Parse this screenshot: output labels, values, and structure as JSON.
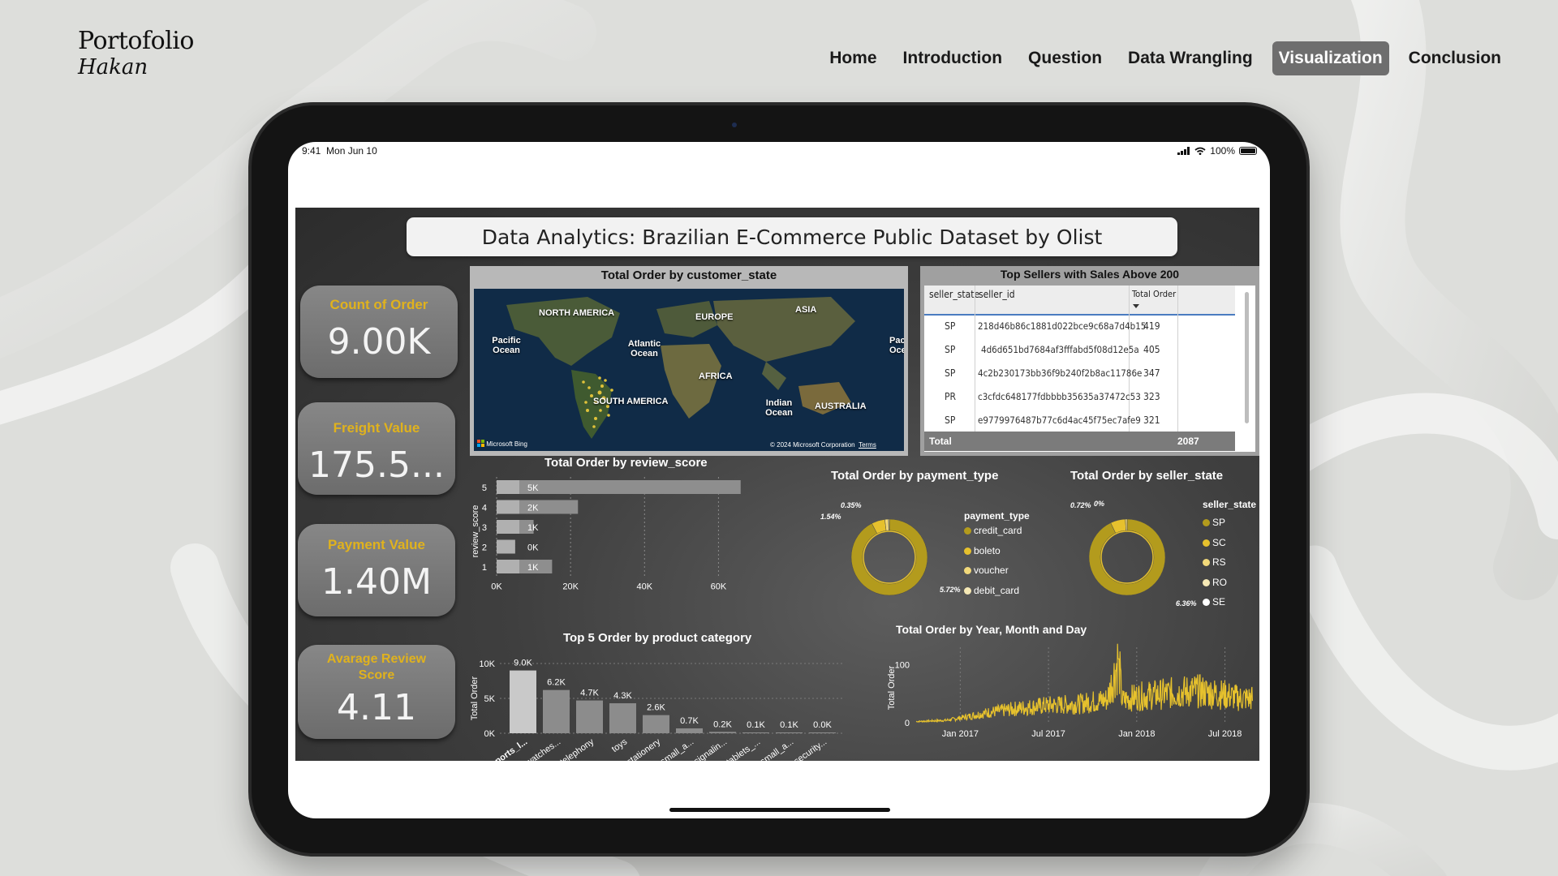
{
  "brand": {
    "name": "Portofolio",
    "sub": "Hakan"
  },
  "nav": [
    {
      "label": "Home",
      "active": false
    },
    {
      "label": "Introduction",
      "active": false
    },
    {
      "label": "Question",
      "active": false
    },
    {
      "label": "Data Wrangling",
      "active": false
    },
    {
      "label": "Visualization",
      "active": true
    },
    {
      "label": "Conclusion",
      "active": false
    }
  ],
  "status": {
    "time": "9:41",
    "date": "Mon Jun 10",
    "battery": "100%"
  },
  "dashboard": {
    "title": "Data Analytics: Brazilian E-Commerce Public Dataset by Olist",
    "kpis": [
      {
        "label": "Count of Order",
        "value": "9.00K"
      },
      {
        "label": "Freight Value",
        "value": "175.5..."
      },
      {
        "label": "Payment Value",
        "value": "1.40M"
      },
      {
        "label": "Avarage Review Score",
        "value": "4.11"
      }
    ],
    "map": {
      "title": "Total Order by customer_state",
      "labels": {
        "north_america": "NORTH AMERICA",
        "europe": "EUROPE",
        "asia": "ASIA",
        "africa": "AFRICA",
        "south_america": "SOUTH AMERICA",
        "australia": "AUSTRALIA",
        "pacific": "Pacific Ocean",
        "atlantic": "Atlantic Ocean",
        "indian": "Indian Ocean",
        "pacific_right": "Pac Oce"
      },
      "attribution_left": "Microsoft Bing",
      "attribution_right": "© 2024 Microsoft Corporation",
      "terms": "Terms"
    },
    "table": {
      "title": "Top Sellers with Sales Above 200",
      "columns": [
        "seller_state",
        "seller_id",
        "Total Order"
      ],
      "rows": [
        {
          "state": "SP",
          "id": "218d46b86c1881d022bce9c68a7d4b15",
          "total": "419"
        },
        {
          "state": "SP",
          "id": "4d6d651bd7684af3fffabd5f08d12e5a",
          "total": "405"
        },
        {
          "state": "SP",
          "id": "4c2b230173bb36f9b240f2b8ac11786e",
          "total": "347"
        },
        {
          "state": "PR",
          "id": "c3cfdc648177fdbbbb35635a37472c53",
          "total": "323"
        },
        {
          "state": "SP",
          "id": "e9779976487b77c6d4ac45f75ec7afe9",
          "total": "321"
        }
      ],
      "total_label": "Total",
      "total_value": "2087"
    },
    "charts": {
      "review": {
        "title": "Total Order by review_score"
      },
      "payment": {
        "title": "Total Order by payment_type"
      },
      "seller": {
        "title": "Total Order by seller_state"
      },
      "category": {
        "title": "Top 5 Order by product category"
      },
      "timeline": {
        "title": "Total Order by Year, Month and Day"
      }
    }
  },
  "chart_data": [
    {
      "type": "bar",
      "orientation": "horizontal",
      "title": "Total Order by review_score",
      "ylabel": "review_score",
      "categories": [
        "5",
        "4",
        "3",
        "2",
        "1"
      ],
      "values": [
        66000,
        22000,
        10000,
        5000,
        15000
      ],
      "data_labels": [
        "5K",
        "2K",
        "1K",
        "0K",
        "1K"
      ],
      "xticks": [
        "0K",
        "20K",
        "40K",
        "60K"
      ],
      "xlim": [
        0,
        70000
      ],
      "grid": true
    },
    {
      "type": "pie",
      "title": "Total Order by payment_type",
      "legend_title": "payment_type",
      "categories": [
        "credit_card",
        "boleto",
        "voucher",
        "debit_card"
      ],
      "values": [
        92.39,
        5.72,
        1.54,
        0.35
      ],
      "data_labels": [
        "0.35%",
        "1.54%",
        "5.72%"
      ],
      "colors": [
        "#b39b1d",
        "#e6c12d",
        "#f2d97a",
        "#f5e8b5"
      ],
      "legend": "right"
    },
    {
      "type": "pie",
      "title": "Total Order by seller_state",
      "legend_title": "seller_state",
      "categories": [
        "SP",
        "SC",
        "RS",
        "RO",
        "SE"
      ],
      "values": [
        92.92,
        6.36,
        0.72,
        0.0,
        0.0
      ],
      "data_labels": [
        "0.72%",
        "0%",
        "6.36%"
      ],
      "colors": [
        "#b39b1d",
        "#e6c12d",
        "#f2d97a",
        "#f5e8b5",
        "#ffffff"
      ],
      "legend": "right"
    },
    {
      "type": "bar",
      "title": "Top 5 Order by product category",
      "ylabel": "Total Order",
      "categories": [
        "sports_l...",
        "watches...",
        "telephony",
        "toys",
        "stationery",
        "small_a...",
        "signalin...",
        "tablets_...",
        "small_a...",
        "security..."
      ],
      "values": [
        9000,
        6200,
        4700,
        4300,
        2600,
        700,
        200,
        100,
        100,
        0
      ],
      "data_labels": [
        "9.0K",
        "6.2K",
        "4.7K",
        "4.3K",
        "2.6K",
        "0.7K",
        "0.2K",
        "0.1K",
        "0.1K",
        "0.0K"
      ],
      "yticks": [
        "0K",
        "5K",
        "10K"
      ],
      "ylim": [
        0,
        10000
      ]
    },
    {
      "type": "line",
      "title": "Total Order by Year, Month and Day",
      "ylabel": "Total Order",
      "xticks": [
        "Jan 2017",
        "Jul 2017",
        "Jan 2018",
        "Jul 2018"
      ],
      "yticks": [
        "0",
        "100"
      ],
      "ylim": [
        0,
        130
      ],
      "x": [
        "2016-10",
        "2016-12",
        "2017-01",
        "2017-03",
        "2017-05",
        "2017-07",
        "2017-09",
        "2017-11",
        "2017-11-24",
        "2017-12",
        "2018-01",
        "2018-03",
        "2018-05",
        "2018-07",
        "2018-08"
      ],
      "y": [
        2,
        4,
        8,
        18,
        25,
        30,
        32,
        40,
        110,
        38,
        45,
        50,
        55,
        48,
        42
      ]
    }
  ]
}
